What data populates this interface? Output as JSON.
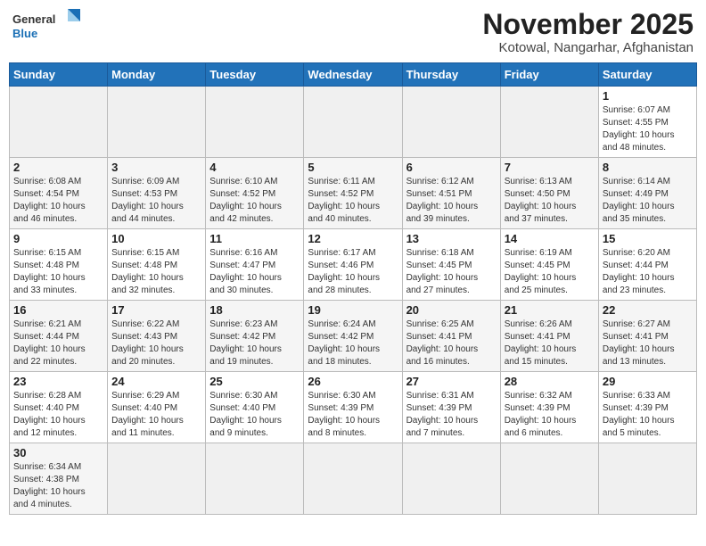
{
  "header": {
    "logo_line1": "General",
    "logo_line2": "Blue",
    "month_title": "November 2025",
    "subtitle": "Kotowal, Nangarhar, Afghanistan"
  },
  "days_of_week": [
    "Sunday",
    "Monday",
    "Tuesday",
    "Wednesday",
    "Thursday",
    "Friday",
    "Saturday"
  ],
  "weeks": [
    [
      {
        "day": "",
        "info": ""
      },
      {
        "day": "",
        "info": ""
      },
      {
        "day": "",
        "info": ""
      },
      {
        "day": "",
        "info": ""
      },
      {
        "day": "",
        "info": ""
      },
      {
        "day": "",
        "info": ""
      },
      {
        "day": "1",
        "info": "Sunrise: 6:07 AM\nSunset: 4:55 PM\nDaylight: 10 hours\nand 48 minutes."
      }
    ],
    [
      {
        "day": "2",
        "info": "Sunrise: 6:08 AM\nSunset: 4:54 PM\nDaylight: 10 hours\nand 46 minutes."
      },
      {
        "day": "3",
        "info": "Sunrise: 6:09 AM\nSunset: 4:53 PM\nDaylight: 10 hours\nand 44 minutes."
      },
      {
        "day": "4",
        "info": "Sunrise: 6:10 AM\nSunset: 4:52 PM\nDaylight: 10 hours\nand 42 minutes."
      },
      {
        "day": "5",
        "info": "Sunrise: 6:11 AM\nSunset: 4:52 PM\nDaylight: 10 hours\nand 40 minutes."
      },
      {
        "day": "6",
        "info": "Sunrise: 6:12 AM\nSunset: 4:51 PM\nDaylight: 10 hours\nand 39 minutes."
      },
      {
        "day": "7",
        "info": "Sunrise: 6:13 AM\nSunset: 4:50 PM\nDaylight: 10 hours\nand 37 minutes."
      },
      {
        "day": "8",
        "info": "Sunrise: 6:14 AM\nSunset: 4:49 PM\nDaylight: 10 hours\nand 35 minutes."
      }
    ],
    [
      {
        "day": "9",
        "info": "Sunrise: 6:15 AM\nSunset: 4:48 PM\nDaylight: 10 hours\nand 33 minutes."
      },
      {
        "day": "10",
        "info": "Sunrise: 6:15 AM\nSunset: 4:48 PM\nDaylight: 10 hours\nand 32 minutes."
      },
      {
        "day": "11",
        "info": "Sunrise: 6:16 AM\nSunset: 4:47 PM\nDaylight: 10 hours\nand 30 minutes."
      },
      {
        "day": "12",
        "info": "Sunrise: 6:17 AM\nSunset: 4:46 PM\nDaylight: 10 hours\nand 28 minutes."
      },
      {
        "day": "13",
        "info": "Sunrise: 6:18 AM\nSunset: 4:45 PM\nDaylight: 10 hours\nand 27 minutes."
      },
      {
        "day": "14",
        "info": "Sunrise: 6:19 AM\nSunset: 4:45 PM\nDaylight: 10 hours\nand 25 minutes."
      },
      {
        "day": "15",
        "info": "Sunrise: 6:20 AM\nSunset: 4:44 PM\nDaylight: 10 hours\nand 23 minutes."
      }
    ],
    [
      {
        "day": "16",
        "info": "Sunrise: 6:21 AM\nSunset: 4:44 PM\nDaylight: 10 hours\nand 22 minutes."
      },
      {
        "day": "17",
        "info": "Sunrise: 6:22 AM\nSunset: 4:43 PM\nDaylight: 10 hours\nand 20 minutes."
      },
      {
        "day": "18",
        "info": "Sunrise: 6:23 AM\nSunset: 4:42 PM\nDaylight: 10 hours\nand 19 minutes."
      },
      {
        "day": "19",
        "info": "Sunrise: 6:24 AM\nSunset: 4:42 PM\nDaylight: 10 hours\nand 18 minutes."
      },
      {
        "day": "20",
        "info": "Sunrise: 6:25 AM\nSunset: 4:41 PM\nDaylight: 10 hours\nand 16 minutes."
      },
      {
        "day": "21",
        "info": "Sunrise: 6:26 AM\nSunset: 4:41 PM\nDaylight: 10 hours\nand 15 minutes."
      },
      {
        "day": "22",
        "info": "Sunrise: 6:27 AM\nSunset: 4:41 PM\nDaylight: 10 hours\nand 13 minutes."
      }
    ],
    [
      {
        "day": "23",
        "info": "Sunrise: 6:28 AM\nSunset: 4:40 PM\nDaylight: 10 hours\nand 12 minutes."
      },
      {
        "day": "24",
        "info": "Sunrise: 6:29 AM\nSunset: 4:40 PM\nDaylight: 10 hours\nand 11 minutes."
      },
      {
        "day": "25",
        "info": "Sunrise: 6:30 AM\nSunset: 4:40 PM\nDaylight: 10 hours\nand 9 minutes."
      },
      {
        "day": "26",
        "info": "Sunrise: 6:30 AM\nSunset: 4:39 PM\nDaylight: 10 hours\nand 8 minutes."
      },
      {
        "day": "27",
        "info": "Sunrise: 6:31 AM\nSunset: 4:39 PM\nDaylight: 10 hours\nand 7 minutes."
      },
      {
        "day": "28",
        "info": "Sunrise: 6:32 AM\nSunset: 4:39 PM\nDaylight: 10 hours\nand 6 minutes."
      },
      {
        "day": "29",
        "info": "Sunrise: 6:33 AM\nSunset: 4:39 PM\nDaylight: 10 hours\nand 5 minutes."
      }
    ],
    [
      {
        "day": "30",
        "info": "Sunrise: 6:34 AM\nSunset: 4:38 PM\nDaylight: 10 hours\nand 4 minutes."
      },
      {
        "day": "",
        "info": ""
      },
      {
        "day": "",
        "info": ""
      },
      {
        "day": "",
        "info": ""
      },
      {
        "day": "",
        "info": ""
      },
      {
        "day": "",
        "info": ""
      },
      {
        "day": "",
        "info": ""
      }
    ]
  ]
}
